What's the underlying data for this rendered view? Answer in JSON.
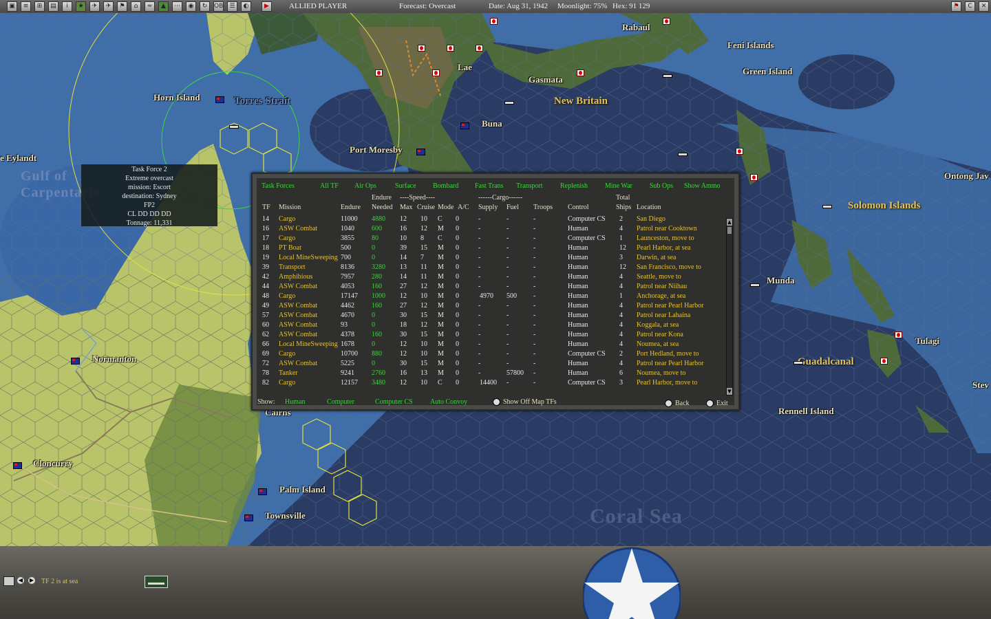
{
  "toolbar": {
    "player": "ALLIED PLAYER",
    "forecast": "Forecast: Overcast",
    "date": "Date: Aug 31, 1942",
    "moonlight": "Moonlight: 75%",
    "hex": "Hex: 91 129",
    "buttons": [
      "toggle-1",
      "notes",
      "options",
      "report",
      "info",
      "airgroup",
      "aircraft",
      "bombers",
      "flag",
      "base",
      "resources",
      "map-filter",
      "air-missions",
      "globe",
      "ob",
      "list",
      "replay",
      "end-turn"
    ]
  },
  "map": {
    "places": [
      "Rabaul",
      "Feni Islands",
      "Green Island",
      "Lae",
      "Gasmata",
      "Horn Island",
      "Torres Strait",
      "Buna",
      "Port Moresby",
      "e Eylandt",
      "Normanton",
      "Cloncurry",
      "Palm Island",
      "Townsville",
      "Munda",
      "Tulagi",
      "Ontong Jav",
      "Rennell Island",
      "Stev",
      "Cairns"
    ],
    "regions": [
      "New Britain",
      "Solomon Islands",
      "Guadalcanal"
    ],
    "seas": [
      "Gulf of Carpentaria",
      "Coral Sea"
    ]
  },
  "tooltip": {
    "lines": [
      "Task Force 2",
      "Extreme overcast",
      "mission: Escort",
      "destination: Sydney",
      "FP2",
      "CL DD DD DD",
      "Tonnage: 11,331"
    ]
  },
  "panel": {
    "title": "Task Forces",
    "tabs": [
      "All TF",
      "Air Ops",
      "Surface",
      "Bombard",
      "Fast Trans",
      "Transport",
      "Replenish",
      "Mine War",
      "Sub Ops",
      "Show Ammo"
    ],
    "headers": {
      "tf": "TF",
      "mission": "Mission",
      "endure": "Endure",
      "endure_needed_1": "Endure",
      "endure_needed_2": "Needed",
      "speed": "----Speed----",
      "max": "Max",
      "cruise": "Cruise",
      "mode": "Mode",
      "ac": "A/C",
      "cargo": "------Cargo------",
      "supply": "Supply",
      "fuel": "Fuel",
      "troops": "Troops",
      "control": "Control",
      "total": "Total",
      "ships": "Ships",
      "location": "Location"
    },
    "rows": [
      {
        "tf": "14",
        "mission": "Cargo",
        "endure": "11000",
        "needed": "4880",
        "max": "12",
        "cruise": "10",
        "mode": "C",
        "ac": "0",
        "supply": "-",
        "fuel": "-",
        "troops": "-",
        "control": "Computer CS",
        "ships": "2",
        "location": "San Diego"
      },
      {
        "tf": "16",
        "mission": "ASW Combat",
        "endure": "1040",
        "needed": "600",
        "max": "16",
        "cruise": "12",
        "mode": "M",
        "ac": "0",
        "supply": "-",
        "fuel": "-",
        "troops": "-",
        "control": "Human",
        "ships": "4",
        "location": "Patrol near Cooktown"
      },
      {
        "tf": "17",
        "mission": "Cargo",
        "endure": "3855",
        "needed": "80",
        "max": "10",
        "cruise": "8",
        "mode": "C",
        "ac": "0",
        "supply": "-",
        "fuel": "-",
        "troops": "-",
        "control": "Computer CS",
        "ships": "1",
        "location": "Launceston, move to"
      },
      {
        "tf": "18",
        "mission": "PT Boat",
        "endure": "500",
        "needed": "0",
        "max": "39",
        "cruise": "15",
        "mode": "M",
        "ac": "0",
        "supply": "-",
        "fuel": "-",
        "troops": "-",
        "control": "Human",
        "ships": "12",
        "location": "Pearl Harbor, at sea"
      },
      {
        "tf": "19",
        "mission": "Local MineSweeping",
        "endure": "700",
        "needed": "0",
        "max": "14",
        "cruise": "7",
        "mode": "M",
        "ac": "0",
        "supply": "-",
        "fuel": "-",
        "troops": "-",
        "control": "Human",
        "ships": "3",
        "location": "Darwin, at sea"
      },
      {
        "tf": "39",
        "mission": "Transport",
        "endure": "8136",
        "needed": "3280",
        "max": "13",
        "cruise": "11",
        "mode": "M",
        "ac": "0",
        "supply": "-",
        "fuel": "-",
        "troops": "-",
        "control": "Human",
        "ships": "12",
        "location": "San Francisco, move to"
      },
      {
        "tf": "42",
        "mission": "Amphibious",
        "endure": "7957",
        "needed": "280",
        "max": "14",
        "cruise": "11",
        "mode": "M",
        "ac": "0",
        "supply": "-",
        "fuel": "-",
        "troops": "-",
        "control": "Human",
        "ships": "4",
        "location": "Seattle, move to"
      },
      {
        "tf": "44",
        "mission": "ASW Combat",
        "endure": "4053",
        "needed": "160",
        "max": "27",
        "cruise": "12",
        "mode": "M",
        "ac": "0",
        "supply": "-",
        "fuel": "-",
        "troops": "-",
        "control": "Human",
        "ships": "4",
        "location": "Patrol near Niihau"
      },
      {
        "tf": "48",
        "mission": "Cargo",
        "endure": "17147",
        "needed": "1000",
        "max": "12",
        "cruise": "10",
        "mode": "M",
        "ac": "0",
        "supply": "4970",
        "fuel": "500",
        "troops": "-",
        "control": "Human",
        "ships": "1",
        "location": "Anchorage, at sea"
      },
      {
        "tf": "49",
        "mission": "ASW Combat",
        "endure": "4462",
        "needed": "160",
        "max": "27",
        "cruise": "12",
        "mode": "M",
        "ac": "0",
        "supply": "-",
        "fuel": "-",
        "troops": "-",
        "control": "Human",
        "ships": "4",
        "location": "Patrol near Pearl Harbor"
      },
      {
        "tf": "57",
        "mission": "ASW Combat",
        "endure": "4670",
        "needed": "0",
        "max": "30",
        "cruise": "15",
        "mode": "M",
        "ac": "0",
        "supply": "-",
        "fuel": "-",
        "troops": "-",
        "control": "Human",
        "ships": "4",
        "location": "Patrol near Lahaina"
      },
      {
        "tf": "60",
        "mission": "ASW Combat",
        "endure": "93",
        "needed": "0",
        "max": "18",
        "cruise": "12",
        "mode": "M",
        "ac": "0",
        "supply": "-",
        "fuel": "-",
        "troops": "-",
        "control": "Human",
        "ships": "4",
        "location": "Koggala, at sea"
      },
      {
        "tf": "62",
        "mission": "ASW Combat",
        "endure": "4378",
        "needed": "160",
        "max": "30",
        "cruise": "15",
        "mode": "M",
        "ac": "0",
        "supply": "-",
        "fuel": "-",
        "troops": "-",
        "control": "Human",
        "ships": "4",
        "location": "Patrol near Kona"
      },
      {
        "tf": "66",
        "mission": "Local MineSweeping",
        "endure": "1678",
        "needed": "0",
        "max": "12",
        "cruise": "10",
        "mode": "M",
        "ac": "0",
        "supply": "-",
        "fuel": "-",
        "troops": "-",
        "control": "Human",
        "ships": "4",
        "location": "Noumea, at sea"
      },
      {
        "tf": "69",
        "mission": "Cargo",
        "endure": "10700",
        "needed": "880",
        "max": "12",
        "cruise": "10",
        "mode": "M",
        "ac": "0",
        "supply": "-",
        "fuel": "-",
        "troops": "-",
        "control": "Computer CS",
        "ships": "2",
        "location": "Port Hedland, move to"
      },
      {
        "tf": "72",
        "mission": "ASW Combat",
        "endure": "5225",
        "needed": "0",
        "max": "30",
        "cruise": "15",
        "mode": "M",
        "ac": "0",
        "supply": "-",
        "fuel": "-",
        "troops": "-",
        "control": "Human",
        "ships": "4",
        "location": "Patrol near Pearl Harbor"
      },
      {
        "tf": "78",
        "mission": "Tanker",
        "endure": "9241",
        "needed": "2760",
        "max": "16",
        "cruise": "13",
        "mode": "M",
        "ac": "0",
        "supply": "-",
        "fuel": "57800",
        "troops": "-",
        "control": "Human",
        "ships": "6",
        "location": "Noumea, move to"
      },
      {
        "tf": "82",
        "mission": "Cargo",
        "endure": "12157",
        "needed": "3480",
        "max": "12",
        "cruise": "10",
        "mode": "C",
        "ac": "0",
        "supply": "14400",
        "fuel": "-",
        "troops": "-",
        "control": "Computer CS",
        "ships": "3",
        "location": "Pearl Harbor, move to"
      }
    ],
    "show_label": "Show:",
    "show_options": [
      "Human",
      "Computer",
      "Computer CS",
      "Auto Convoy"
    ],
    "show_off_map": "Show Off Map TFs",
    "back": "Back",
    "exit": "Exit"
  },
  "bottom": {
    "status": "TF 2 is at sea"
  },
  "colors": {
    "land": "#b9c46a",
    "ocean_deep": "#2b3c64",
    "ocean_shallow": "#4a78b0",
    "jungle": "#4f6a3a",
    "tab_green": "#3fd53f",
    "mission_yellow": "#e3c23c"
  }
}
